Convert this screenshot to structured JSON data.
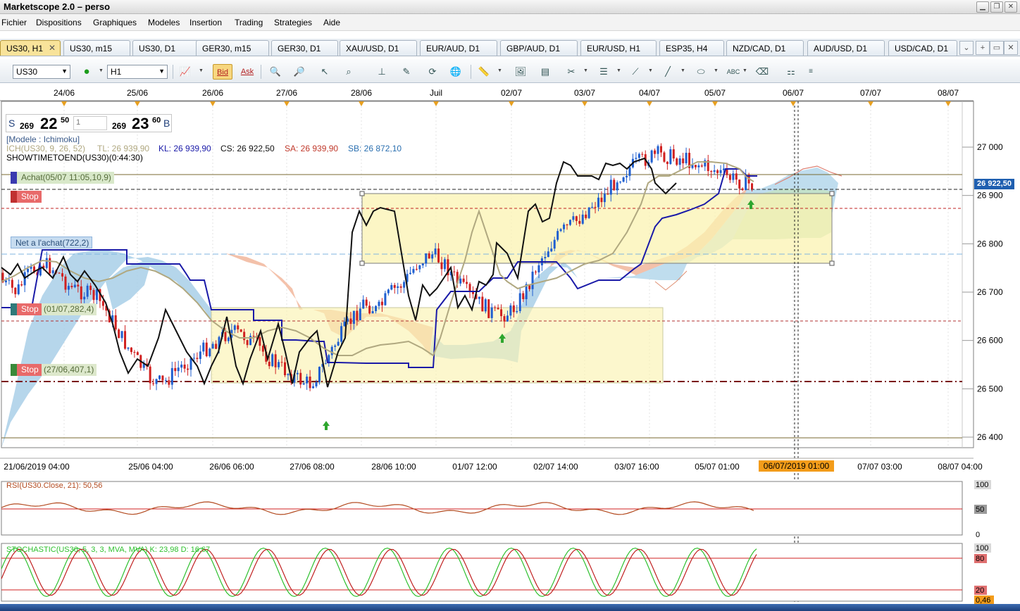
{
  "window": {
    "title": "Marketscope 2.0 – perso"
  },
  "menu": [
    "Fichier",
    "Dispositions",
    "Graphiques",
    "Modeles",
    "Insertion",
    "Trading",
    "Strategies",
    "Aide"
  ],
  "tabs": [
    {
      "label": "US30, H1",
      "active": true
    },
    {
      "label": "US30, m15"
    },
    {
      "label": "US30, D1"
    },
    {
      "label": "GER30, m15"
    },
    {
      "label": "GER30, D1"
    },
    {
      "label": "XAU/USD, D1"
    },
    {
      "label": "EUR/AUD, D1"
    },
    {
      "label": "GBP/AUD, D1"
    },
    {
      "label": "EUR/USD, H1"
    },
    {
      "label": "ESP35, H4"
    },
    {
      "label": "NZD/CAD, D1"
    },
    {
      "label": "AUD/USD, D1"
    },
    {
      "label": "USD/CAD, D1"
    }
  ],
  "toolbar": {
    "instrument": "US30",
    "timeframe": "H1",
    "bid_label": "Bid",
    "ask_label": "Ask"
  },
  "quote": {
    "sell_label": "S",
    "sell_big": "269",
    "sell_pips": "22",
    "sell_frac": "50",
    "input_value": "1",
    "buy_big": "269",
    "buy_pips": "23",
    "buy_frac": "60",
    "buy_label": "B"
  },
  "indicators": {
    "model": "[Modele : Ichimoku]",
    "ich_label": "ICH(US30, 9, 26, 52)",
    "tl": "TL: 26 939,90",
    "kl": "KL: 26 939,90",
    "cs": "CS: 26 922,50",
    "sa": "SA: 26 939,90",
    "sb": "SB: 26 872,10",
    "showtime": "SHOWTIMETOEND(US30)(0:44:30)"
  },
  "orders": [
    {
      "type": "Achat",
      "detail": "Achat(05/07 11:05,10,9)",
      "color": "#3a3ab0"
    },
    {
      "type": "Stop",
      "detail": "Stop",
      "color": "#d84040"
    },
    {
      "type": "Net",
      "detail": "Net a l'achat(722,2)",
      "color": "#8fb4dc"
    },
    {
      "type": "Stop",
      "detail": "Stop",
      "extra": "(01/07,282,4)",
      "color": "#2f7a7a"
    },
    {
      "type": "Stop",
      "detail": "Stop",
      "extra": "(27/06,407,1)",
      "color": "#3a8a3a"
    }
  ],
  "price_tag": "26 922,50",
  "date_tag": "06/07/2019 01:00",
  "chart_data": {
    "type": "line",
    "top_dates": [
      "24/06",
      "25/06",
      "26/06",
      "27/06",
      "28/06",
      "Juil",
      "02/07",
      "03/07",
      "04/07",
      "05/07",
      "06/07",
      "07/07",
      "08/07"
    ],
    "x_labels": [
      "21/06/2019 04:00",
      "25/06 04:00",
      "26/06 06:00",
      "27/06 08:00",
      "28/06 10:00",
      "01/07 12:00",
      "02/07 14:00",
      "03/07 16:00",
      "05/07 01:00",
      "07/07 03:00",
      "08/07 04:00"
    ],
    "y_ticks": [
      "27 000",
      "26 900",
      "26 800",
      "26 700",
      "26 600",
      "26 500",
      "26 400"
    ],
    "ylim": [
      26380,
      27050
    ],
    "close_series": [
      26720,
      26700,
      26740,
      26760,
      26745,
      26710,
      26700,
      26690,
      26650,
      26600,
      26560,
      26520,
      26510,
      26540,
      26560,
      26580,
      26600,
      26620,
      26610,
      26590,
      26560,
      26540,
      26520,
      26510,
      26550,
      26600,
      26640,
      26680,
      26660,
      26700,
      26720,
      26760,
      26780,
      26760,
      26720,
      26690,
      26670,
      26650,
      26660,
      26700,
      26760,
      26800,
      26830,
      26850,
      26880,
      26900,
      26940,
      26960,
      26975,
      26985,
      26980,
      26975,
      26965,
      26955,
      26940,
      26930,
      26922
    ],
    "rsi": {
      "label": "RSI(US30.Close, 21): 50,56",
      "ticks": [
        "100",
        "50",
        "0"
      ]
    },
    "stochastic": {
      "label": "STOCHASTIC(US30, 5, 3, 3, MVA, MVA) K: 23,98   D: 16,67",
      "ticks": [
        "100",
        "80",
        "20",
        "0,46"
      ]
    }
  }
}
